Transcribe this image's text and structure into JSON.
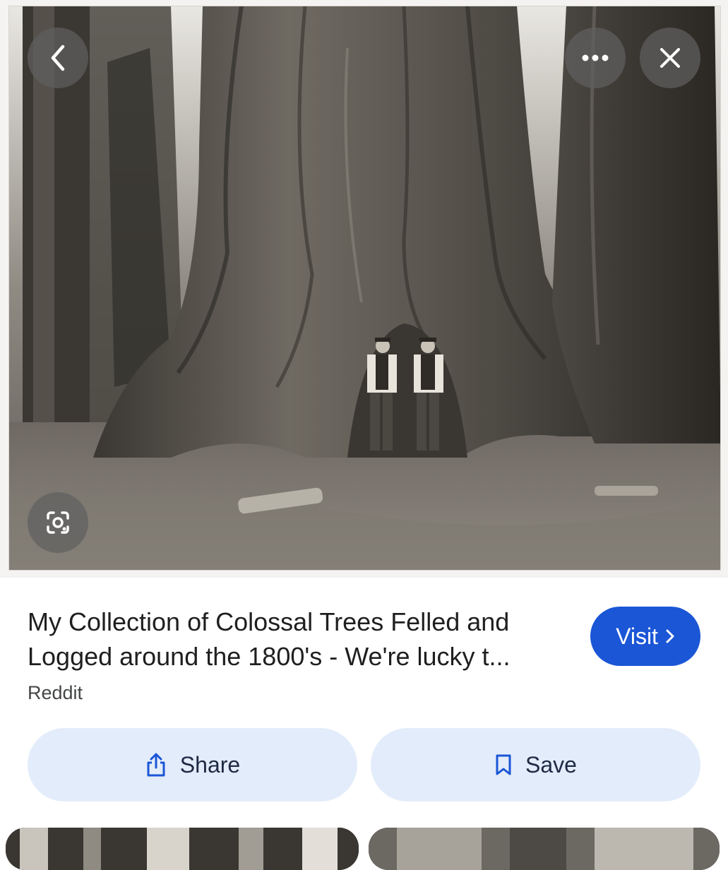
{
  "viewer": {
    "back_icon": "chevron-left-icon",
    "more_icon": "more-horizontal-icon",
    "close_icon": "close-icon",
    "lens_icon": "lens-search-icon"
  },
  "result": {
    "title": "My Collection of Colossal Trees Felled and Logged around the 1800's - We're lucky t...",
    "source": "Reddit",
    "visit_label": "Visit",
    "visit_icon": "chevron-right-icon"
  },
  "actions": {
    "share_label": "Share",
    "share_icon": "share-icon",
    "save_label": "Save",
    "save_icon": "bookmark-icon"
  },
  "colors": {
    "visit_bg": "#1a56d6",
    "action_bg": "#e3ecfa",
    "overlay_btn": "#5f5f5f"
  }
}
